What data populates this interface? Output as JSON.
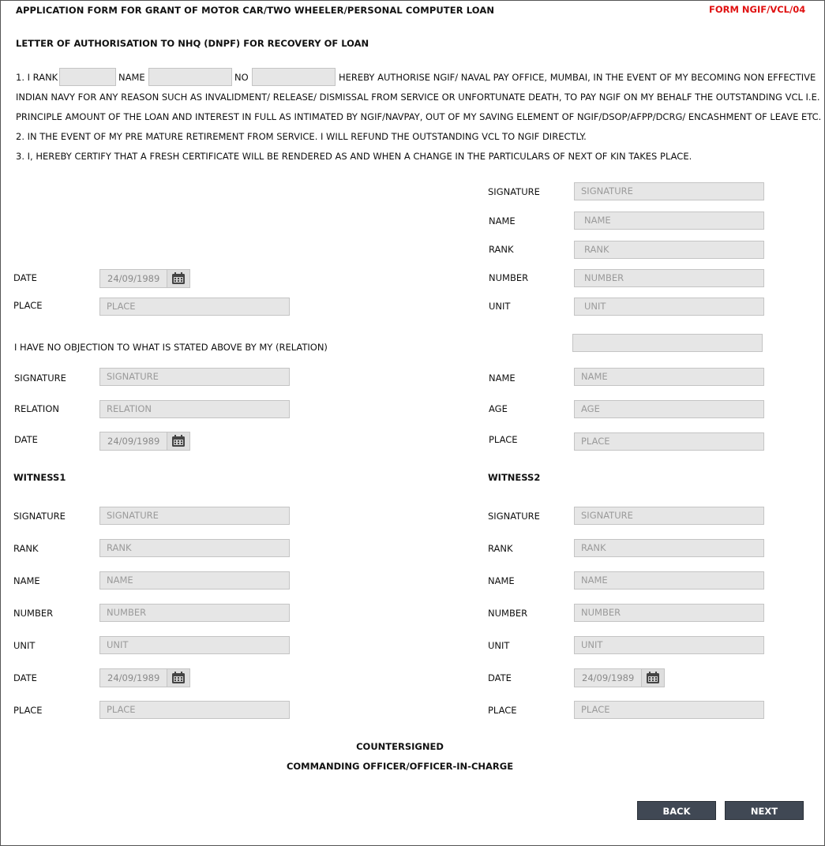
{
  "header": {
    "title": "APPLICATION FORM FOR GRANT OF MOTOR CAR/TWO WHEELER/PERSONAL COMPUTER LOAN",
    "form_no": "FORM NGIF/VCL/04",
    "subtitle": "LETTER OF AUTHORISATION TO NHQ (DNPF) FOR RECOVERY OF LOAN"
  },
  "authorisation": {
    "rank_prefix": "1. I RANK",
    "name_label": "NAME",
    "no_label": "NO",
    "line1_rest": "HEREBY AUTHORISE NGIF/ NAVAL PAY OFFICE, MUMBAI, IN THE EVENT OF MY BECOMING NON EFFECTIVE",
    "line2": "INDIAN NAVY FOR ANY REASON SUCH AS INVALIDMENT/ RELEASE/ DISMISSAL FROM SERVICE OR UNFORTUNATE DEATH, TO PAY NGIF ON MY BEHALF THE OUTSTANDING VCL I.E.",
    "line3": "PRINCIPLE AMOUNT OF THE LOAN AND INTEREST IN FULL AS INTIMATED BY NGIF/NAVPAY, OUT OF MY SAVING ELEMENT OF NGIF/DSOP/AFPP/DCRG/ ENCASHMENT OF LEAVE ETC.",
    "line4": "2. IN THE EVENT OF MY PRE MATURE RETIREMENT FROM SERVICE. I WILL REFUND THE OUTSTANDING VCL TO NGIF DIRECTLY.",
    "line5": "3. I, HEREBY CERTIFY THAT A FRESH CERTIFICATE WILL BE RENDERED AS AND WHEN A CHANGE IN THE PARTICULARS OF NEXT OF KIN TAKES PLACE."
  },
  "applicant": {
    "signature_label": "SIGNATURE",
    "signature_placeholder": "SIGNATURE",
    "name_label": "NAME",
    "name_placeholder": "NAME",
    "rank_label": "RANK",
    "rank_placeholder": "RANK",
    "number_label": "NUMBER",
    "number_placeholder": "NUMBER",
    "unit_label": "UNIT",
    "unit_placeholder": "UNIT",
    "date_label": "DATE",
    "date_value": "24/09/1989",
    "place_label": "PLACE",
    "place_placeholder": "PLACE"
  },
  "relation_section": {
    "statement": "I HAVE NO OBJECTION TO WHAT IS STATED ABOVE BY MY (RELATION)",
    "signature_label": "SIGNATURE",
    "signature_placeholder": "SIGNATURE",
    "relation_label": "RELATION",
    "relation_placeholder": "RELATION",
    "date_label": "DATE",
    "date_value": "24/09/1989",
    "name_label": "NAME",
    "name_placeholder": "NAME",
    "age_label": "AGE",
    "age_placeholder": "AGE",
    "place_label": "PLACE",
    "place_placeholder": "PLACE"
  },
  "witness1": {
    "heading": "WITNESS1",
    "signature_label": "SIGNATURE",
    "signature_placeholder": "SIGNATURE",
    "rank_label": "RANK",
    "rank_placeholder": "RANK",
    "name_label": "NAME",
    "name_placeholder": "NAME",
    "number_label": "NUMBER",
    "number_placeholder": "NUMBER",
    "unit_label": "UNIT",
    "unit_placeholder": "UNIT",
    "date_label": "DATE",
    "date_value": "24/09/1989",
    "place_label": "PLACE",
    "place_placeholder": "PLACE"
  },
  "witness2": {
    "heading": "WITNESS2",
    "signature_label": "SIGNATURE",
    "signature_placeholder": "SIGNATURE",
    "rank_label": "RANK",
    "rank_placeholder": "RANK",
    "name_label": "NAME",
    "name_placeholder": "NAME",
    "number_label": "NUMBER",
    "number_placeholder": "NUMBER",
    "unit_label": "UNIT",
    "unit_placeholder": "UNIT",
    "date_label": "DATE",
    "date_value": "24/09/1989",
    "place_label": "PLACE",
    "place_placeholder": "PLACE"
  },
  "footer": {
    "countersigned": "COUNTERSIGNED",
    "officer": "COMMANDING OFFICER/OFFICER-IN-CHARGE",
    "back_label": "BACK",
    "next_label": "NEXT"
  },
  "colors": {
    "form_no": "#e01010",
    "button_bg": "#404854",
    "field_bg": "#e6e6e6"
  },
  "icons": {
    "date_picker": "calendar-icon"
  }
}
